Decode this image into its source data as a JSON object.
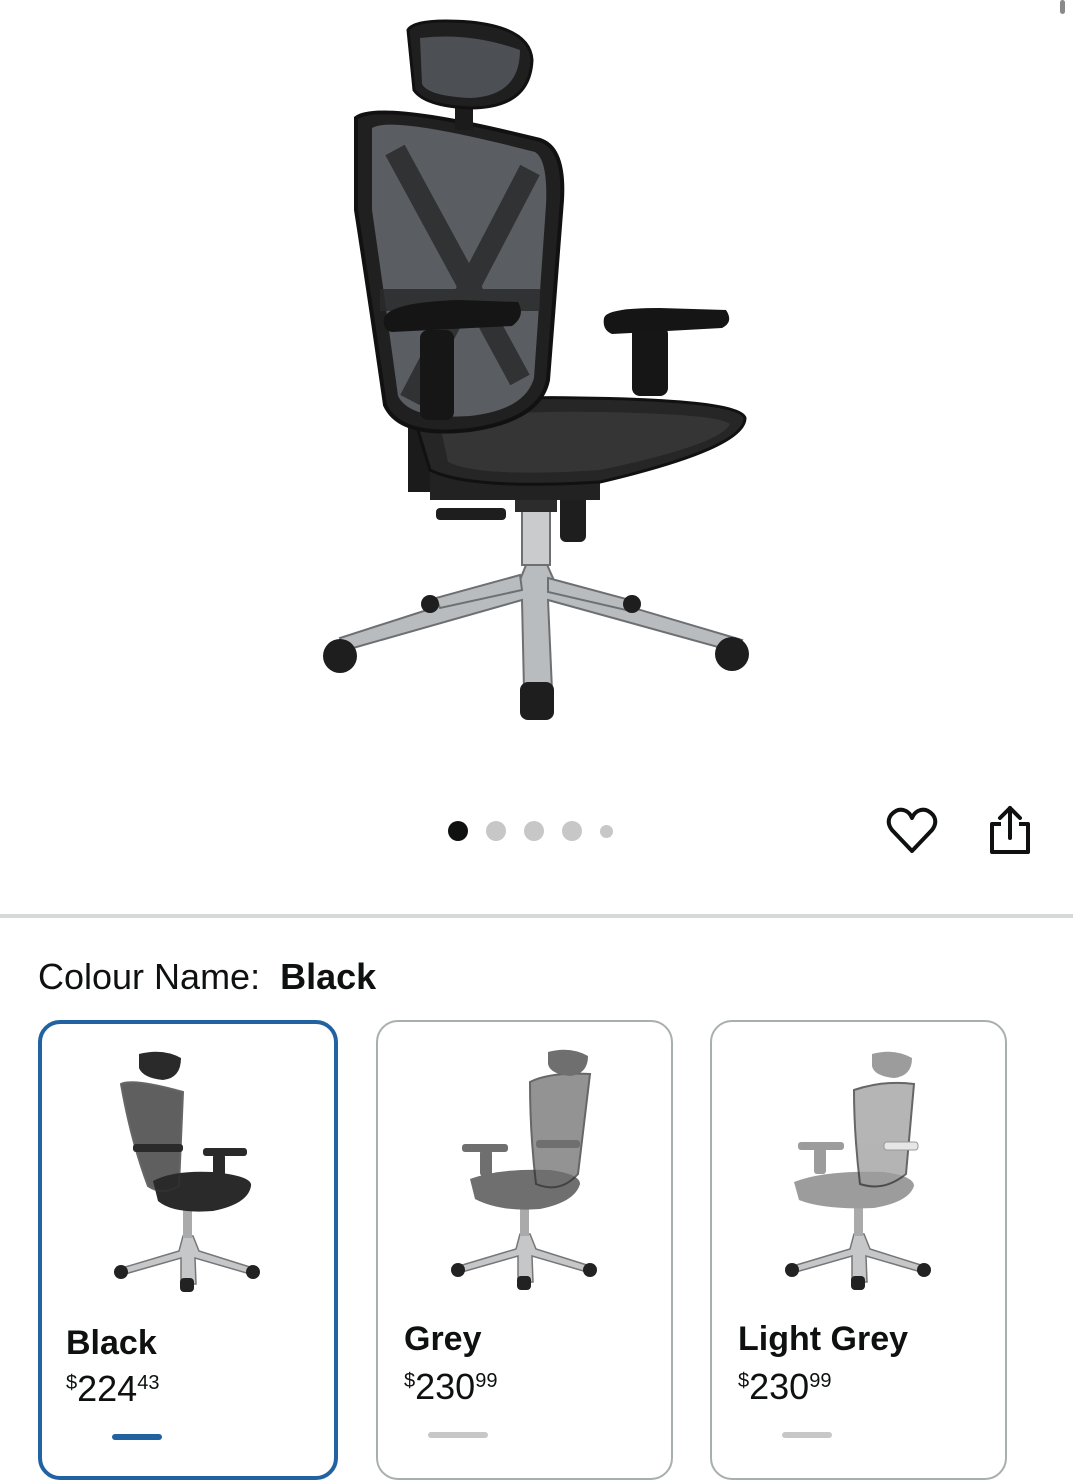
{
  "product_image": {
    "icon": "office-chair-black",
    "carousel_total": 5,
    "carousel_active": 1
  },
  "actions": {
    "favorite_icon": "heart-icon",
    "share_icon": "share-icon"
  },
  "variation": {
    "label": "Colour Name:",
    "selected_value": "Black",
    "options": [
      {
        "name": "Black",
        "currency": "$",
        "price_whole": "224",
        "price_fraction": "43",
        "selected": true,
        "chair_color": "#2a2a2a"
      },
      {
        "name": "Grey",
        "currency": "$",
        "price_whole": "230",
        "price_fraction": "99",
        "selected": false,
        "chair_color": "#6f6f6f"
      },
      {
        "name": "Light Grey",
        "currency": "$",
        "price_whole": "230",
        "price_fraction": "99",
        "selected": false,
        "chair_color": "#9c9c9c"
      }
    ]
  },
  "colors": {
    "selected_border": "#2162a1",
    "dot_active": "#0f1111",
    "dot_inactive": "#c7c7c7"
  }
}
